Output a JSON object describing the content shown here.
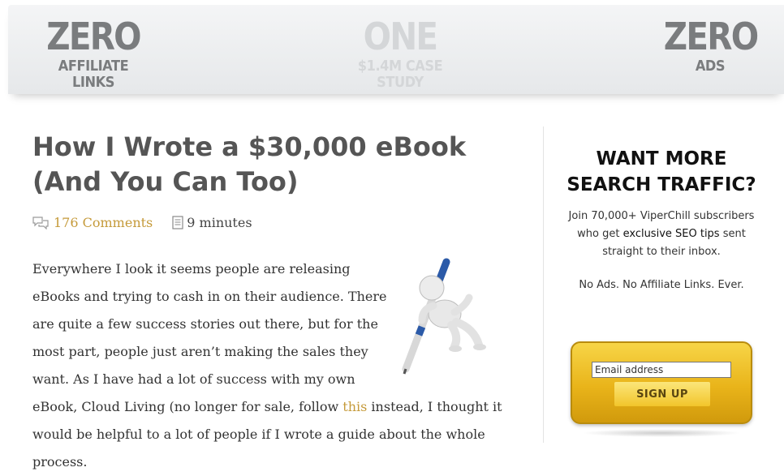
{
  "banner": {
    "left": {
      "big": "ZERO",
      "small": "AFFILIATE LINKS"
    },
    "middle": {
      "big": "ONE",
      "small": "$1.4M CASE STUDY"
    },
    "right": {
      "big": "ZERO",
      "small": "ADS"
    }
  },
  "article": {
    "title": "How I Wrote a $30,000 eBook (And You Can Too)",
    "comments_count_label": "176 Comments",
    "read_time": "9 minutes",
    "icons": {
      "comments": "comments-icon",
      "read_time": "document-icon",
      "image": "pen-figure-illustration"
    },
    "intro_before_link": "Everywhere I look it seems people are releasing eBooks and trying to cash in on their audience. There are quite a few success stories out there, but for the most part, people just aren’t making the sales they want. As I have had a lot of success with my own eBook, Cloud Living (no longer for sale, follow ",
    "intro_link": "this",
    "intro_after_link": " instead, I thought it would be helpful to a lot of people if I wrote a guide about the whole process."
  },
  "sidebar": {
    "title_line1": "WANT MORE",
    "title_line2": "SEARCH TRAFFIC?",
    "text_line1": "Join 70,000+ ViperChill subscribers",
    "text_line2_before": "who get ",
    "text_line2_bold": "exclusive SEO tips",
    "text_line2_after": " sent",
    "text_line3": "straight to their inbox.",
    "note": "No Ads. No Affiliate Links. Ever.",
    "email_placeholder": "Email address",
    "signup_label": "SIGN UP"
  },
  "colors": {
    "link": "#c59a3a",
    "title": "#555555",
    "signup_gold": "#e9b41a"
  }
}
